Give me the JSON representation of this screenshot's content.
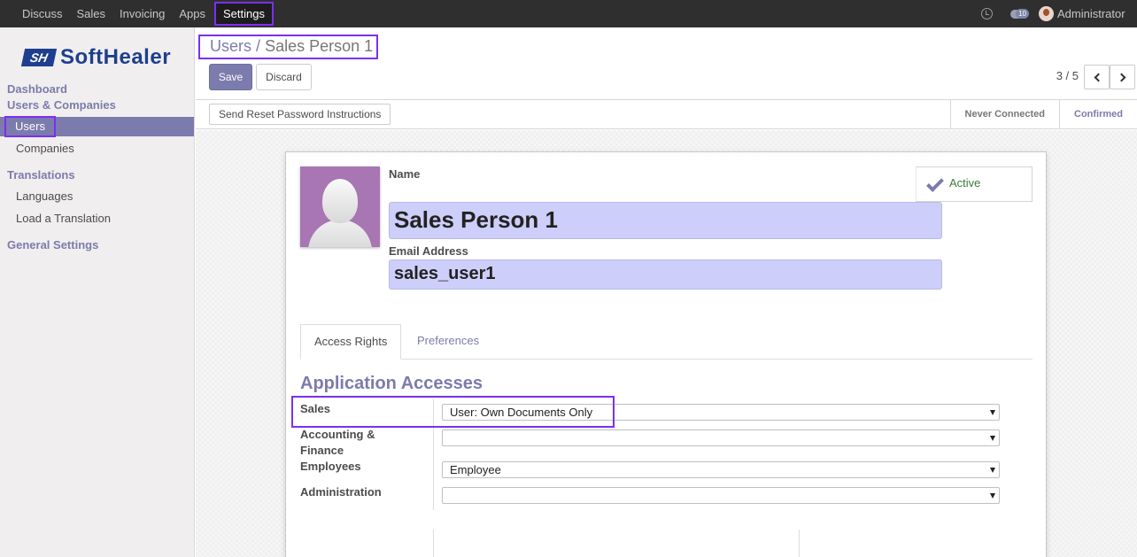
{
  "topbar": {
    "menu": [
      "Discuss",
      "Sales",
      "Invoicing",
      "Apps"
    ],
    "active_menu": "Settings",
    "chat_count": "10",
    "user_name": "Administrator"
  },
  "brand": {
    "logo_mark": "SH",
    "logo_text": "SoftHealer"
  },
  "sidebar": {
    "dashboard": "Dashboard",
    "users_companies": "Users & Companies",
    "users": "Users",
    "companies": "Companies",
    "translations": "Translations",
    "languages": "Languages",
    "load_translation": "Load a Translation",
    "general_settings": "General Settings"
  },
  "breadcrumb": {
    "parent": "Users",
    "separator": "/",
    "current": "Sales Person 1"
  },
  "buttons": {
    "save": "Save",
    "discard": "Discard",
    "reset_password": "Send Reset Password Instructions"
  },
  "pager": {
    "value": "3 / 5"
  },
  "stages": {
    "never_connected": "Never Connected",
    "confirmed": "Confirmed"
  },
  "form": {
    "name_label": "Name",
    "name_value": "Sales Person 1",
    "email_label": "Email Address",
    "email_value": "sales_user1",
    "active_label": "Active",
    "tabs": {
      "access_rights": "Access Rights",
      "preferences": "Preferences"
    },
    "section_title": "Application Accesses",
    "rows": [
      {
        "label": "Sales",
        "value": "User: Own Documents Only"
      },
      {
        "label": "Accounting & Finance",
        "value": ""
      },
      {
        "label": "Employees",
        "value": "Employee"
      },
      {
        "label": "Administration",
        "value": ""
      }
    ]
  },
  "colors": {
    "accent": "#7c7bad",
    "highlight": "#7b2ff0",
    "field_bg": "#cdcffa"
  }
}
